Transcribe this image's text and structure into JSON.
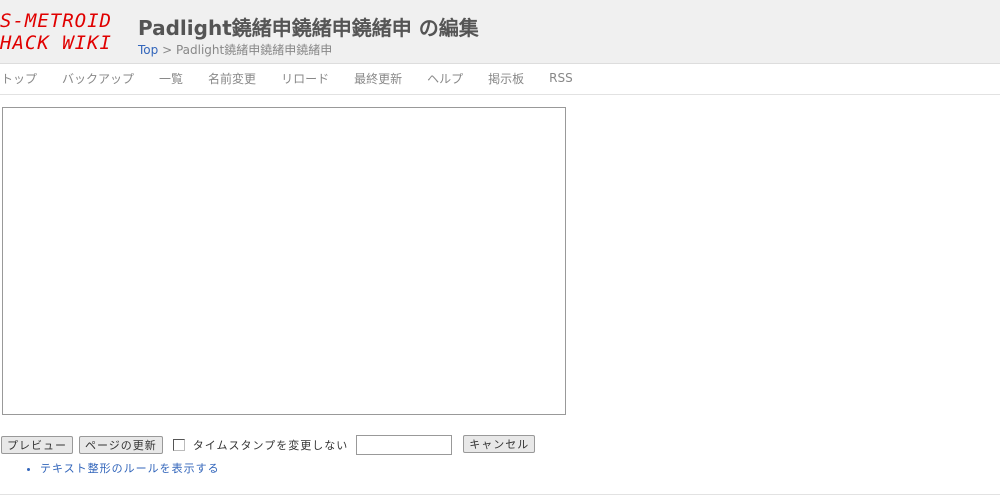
{
  "header": {
    "logo_line1": "S-METROID",
    "logo_line2": "HACK WIKI",
    "title": "Padlight鐃緒申鐃緒申鐃緒申 の編集",
    "breadcrumb_top": "Top",
    "breadcrumb_sep": " > ",
    "breadcrumb_page": "Padlight鐃緒申鐃緒申鐃緒申"
  },
  "nav": {
    "items": [
      {
        "label": "トップ"
      },
      {
        "label": "バックアップ"
      },
      {
        "label": "一覧"
      },
      {
        "label": "名前変更"
      },
      {
        "label": "リロード"
      },
      {
        "label": "最終更新"
      },
      {
        "label": "ヘルプ"
      },
      {
        "label": "掲示板"
      },
      {
        "label": "RSS"
      }
    ]
  },
  "editor": {
    "value": ""
  },
  "form": {
    "preview_label": "プレビュー",
    "update_label": "ページの更新",
    "timestamp_label": "タイムスタンプを変更しない",
    "password_value": "",
    "cancel_label": "キャンセル",
    "rules_link": "テキスト整形のルールを表示する"
  },
  "colors": {
    "logo": "#e00000",
    "link": "#3366bb",
    "header_bg": "#f0f0f0"
  }
}
